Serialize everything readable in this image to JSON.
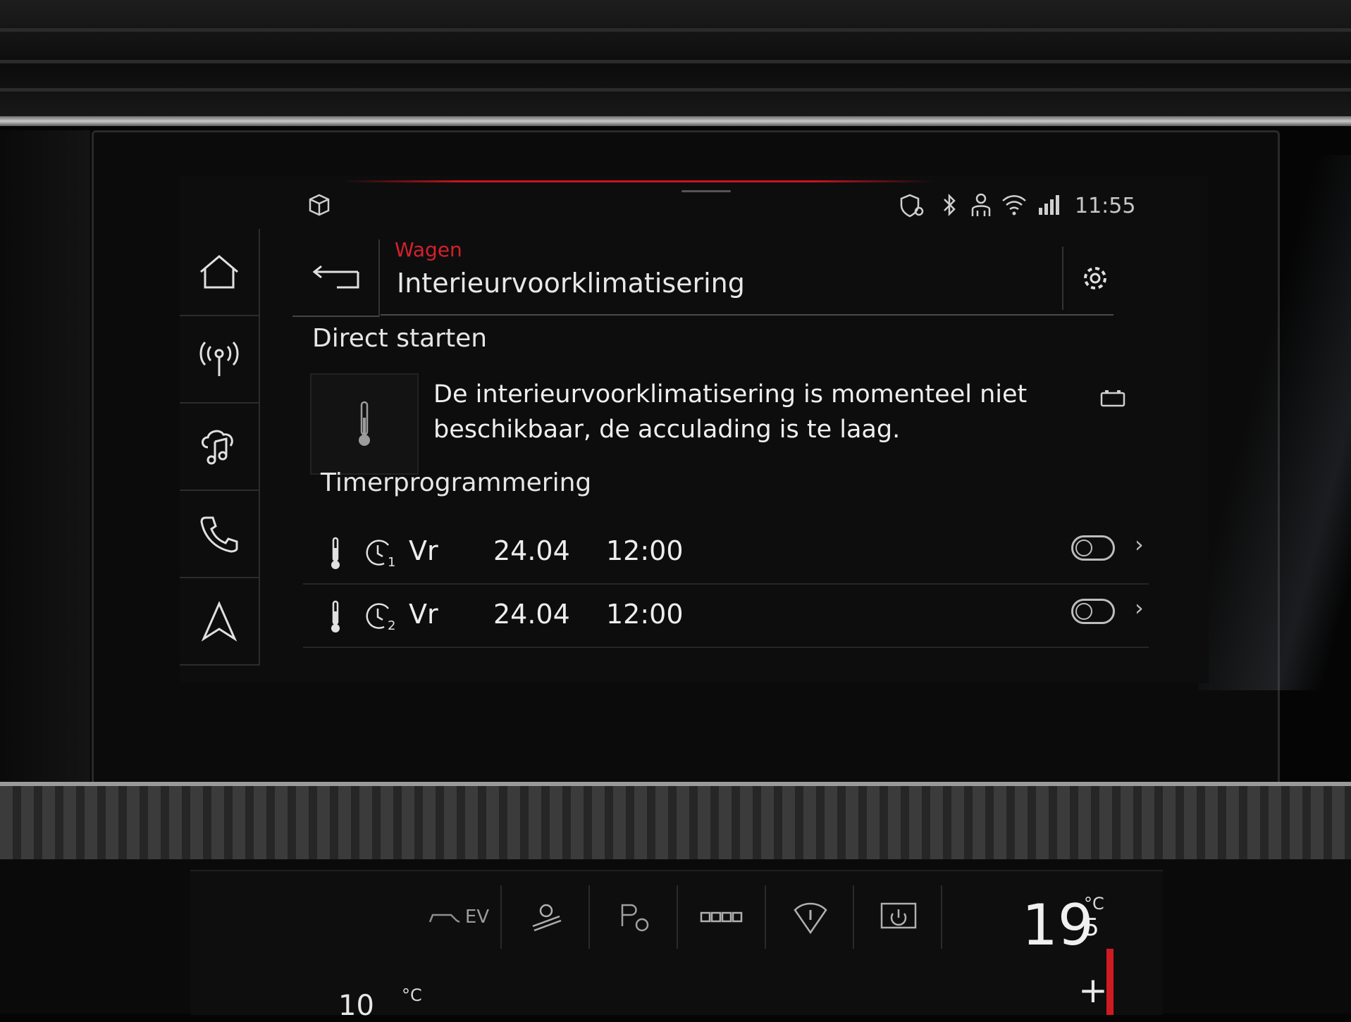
{
  "status": {
    "time": "11:55"
  },
  "header": {
    "breadcrumb": "Wagen",
    "title": "Interieurvoorklimatisering"
  },
  "direct_start": {
    "title": "Direct starten",
    "message": "De interieurvoorklimatisering is momenteel niet beschikbaar, de acculading is te laag."
  },
  "timers": {
    "title": "Timerprogrammering",
    "rows": [
      {
        "timer_number": "1",
        "day": "Vr",
        "date": "24.04",
        "time": "12:00"
      },
      {
        "timer_number": "2",
        "day": "Vr",
        "date": "24.04",
        "time": "12:00"
      }
    ]
  },
  "climate": {
    "ev_label": "EV",
    "temperature_right": "19",
    "temperature_right_decimal": "5",
    "temperature_left": "10",
    "unit": "°C",
    "plus_label": "+",
    "accent_color": "#d01a22"
  },
  "colors": {
    "accent": "#d5202a",
    "text": "#e8e8e8",
    "background": "#0d0d0e"
  }
}
